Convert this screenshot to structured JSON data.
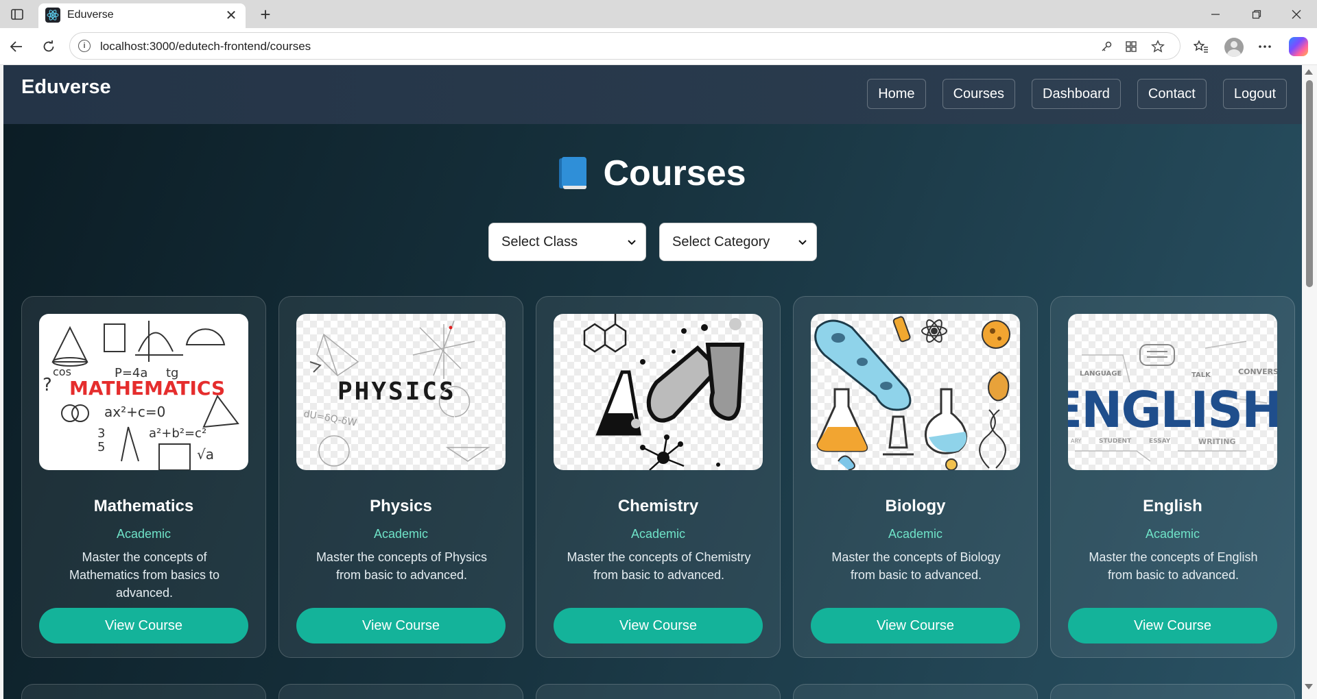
{
  "browser": {
    "tab_title": "Eduverse",
    "url": "localhost:3000/edutech-frontend/courses"
  },
  "site": {
    "brand": "Eduverse",
    "nav": [
      "Home",
      "Courses",
      "Dashboard",
      "Contact",
      "Logout"
    ]
  },
  "page": {
    "title": "Courses",
    "title_icon": "blue-book-icon",
    "filters": {
      "class_select": "Select Class",
      "category_select": "Select Category"
    }
  },
  "courses": [
    {
      "title": "Mathematics",
      "category": "Academic",
      "description": "Master the concepts of Mathematics from basics to advanced.",
      "button": "View Course",
      "thumb_text": "MATHEMATICS"
    },
    {
      "title": "Physics",
      "category": "Academic",
      "description": "Master the concepts of Physics from basic to advanced.",
      "button": "View Course",
      "thumb_text": "PHYSICS"
    },
    {
      "title": "Chemistry",
      "category": "Academic",
      "description": "Master the concepts of Chemistry from basic to advanced.",
      "button": "View Course"
    },
    {
      "title": "Biology",
      "category": "Academic",
      "description": "Master the concepts of Biology from basic to advanced.",
      "button": "View Course"
    },
    {
      "title": "English",
      "category": "Academic",
      "description": "Master the concepts of English from basic to advanced.",
      "button": "View Course",
      "thumb_text": "ENGLISH"
    }
  ],
  "colors": {
    "accent": "#14b39a",
    "category_text": "#6fe3c8",
    "header_bg": "#2c3e50"
  }
}
